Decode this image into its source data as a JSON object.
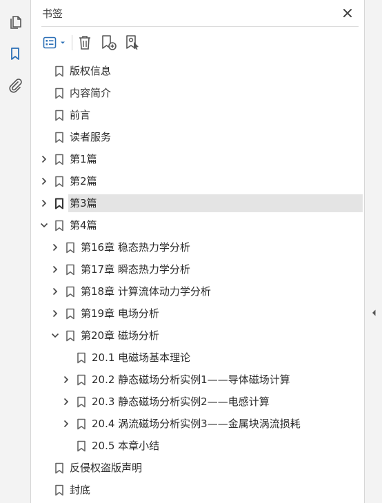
{
  "sidebar_rail": {
    "items": [
      {
        "name": "pages-icon",
        "active": false
      },
      {
        "name": "bookmark-icon",
        "active": true
      },
      {
        "name": "attachment-icon",
        "active": false
      }
    ]
  },
  "panel": {
    "title": "书签",
    "toolbar": {
      "icons": [
        "options-menu-icon",
        "delete-bookmark-icon",
        "new-bookmark-icon",
        "bookmark-from-structure-icon"
      ]
    }
  },
  "bookmarks": [
    {
      "label": "版权信息",
      "level": 0,
      "expander": "none"
    },
    {
      "label": "内容简介",
      "level": 0,
      "expander": "none"
    },
    {
      "label": "前言",
      "level": 0,
      "expander": "none"
    },
    {
      "label": "读者服务",
      "level": 0,
      "expander": "none"
    },
    {
      "label": "第1篇",
      "level": 0,
      "expander": "collapsed"
    },
    {
      "label": "第2篇",
      "level": 0,
      "expander": "collapsed"
    },
    {
      "label": "第3篇",
      "level": 0,
      "expander": "collapsed",
      "selected": true
    },
    {
      "label": "第4篇",
      "level": 0,
      "expander": "expanded"
    },
    {
      "label": "第16章 稳态热力学分析",
      "level": 1,
      "expander": "collapsed"
    },
    {
      "label": "第17章 瞬态热力学分析",
      "level": 1,
      "expander": "collapsed"
    },
    {
      "label": "第18章 计算流体动力学分析",
      "level": 1,
      "expander": "collapsed"
    },
    {
      "label": "第19章 电场分析",
      "level": 1,
      "expander": "collapsed"
    },
    {
      "label": "第20章 磁场分析",
      "level": 1,
      "expander": "expanded"
    },
    {
      "label": "20.1 电磁场基本理论",
      "level": 2,
      "expander": "none"
    },
    {
      "label": "20.2 静态磁场分析实例1——导体磁场计算",
      "level": 2,
      "expander": "collapsed"
    },
    {
      "label": "20.3 静态磁场分析实例2——电感计算",
      "level": 2,
      "expander": "collapsed"
    },
    {
      "label": "20.4 涡流磁场分析实例3——金属块涡流损耗",
      "level": 2,
      "expander": "collapsed"
    },
    {
      "label": "20.5 本章小结",
      "level": 2,
      "expander": "none"
    },
    {
      "label": "反侵权盗版声明",
      "level": 0,
      "expander": "none"
    },
    {
      "label": "封底",
      "level": 0,
      "expander": "none"
    }
  ],
  "colors": {
    "accent": "#2b6fb6",
    "icon": "#555555",
    "selection": "#e4e4e4"
  }
}
